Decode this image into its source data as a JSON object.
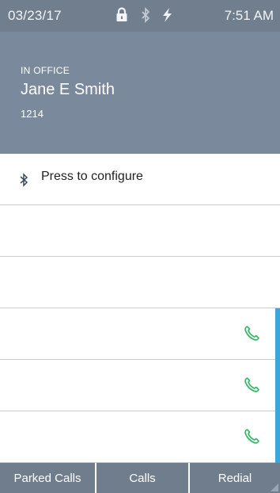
{
  "status_bar": {
    "date": "03/23/17",
    "time": "7:51 AM",
    "icons": [
      "lock-icon",
      "bluetooth-icon",
      "bolt-icon"
    ]
  },
  "user": {
    "presence": "IN OFFICE",
    "name": "Jane E Smith",
    "extension": "1214"
  },
  "lines": [
    {
      "label": "Press to configure",
      "icon": "bluetooth-icon"
    },
    {
      "label": ""
    },
    {
      "label": ""
    },
    {
      "label": "",
      "icon": "phone-icon"
    },
    {
      "label": "",
      "icon": "phone-icon"
    },
    {
      "label": "",
      "icon": "phone-icon"
    }
  ],
  "softkeys": {
    "k1": "Parked Calls",
    "k2": "Calls",
    "k3": "Redial"
  },
  "colors": {
    "header": "#7a8a9c",
    "status_bar": "#707e8e",
    "accent": "#3aa6dc",
    "phone": "#3cb86a"
  }
}
